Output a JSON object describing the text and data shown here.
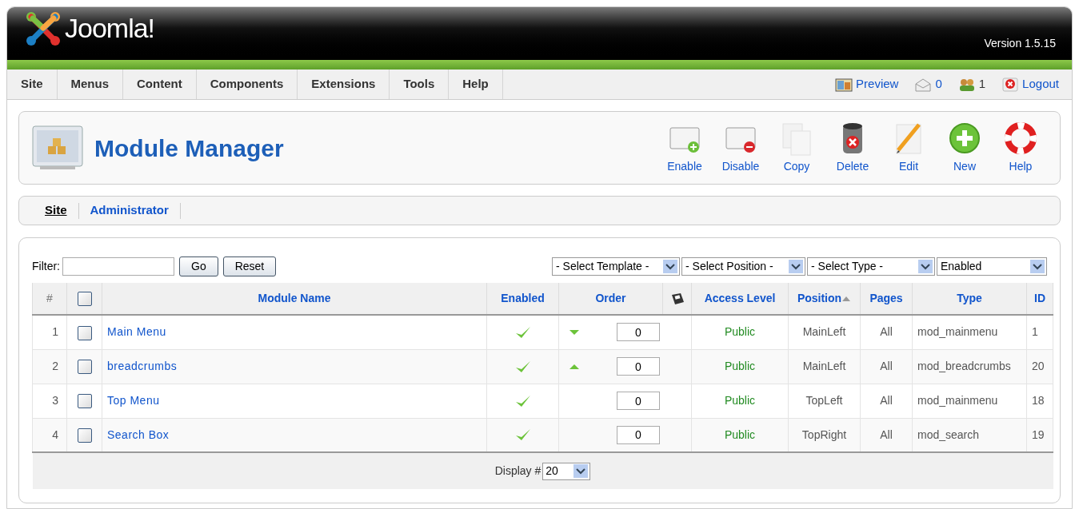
{
  "header": {
    "logo_text": "Joomla!",
    "version": "Version 1.5.15"
  },
  "menu": [
    "Site",
    "Menus",
    "Content",
    "Components",
    "Extensions",
    "Tools",
    "Help"
  ],
  "status": [
    {
      "kind": "preview",
      "label": "Preview"
    },
    {
      "kind": "messages",
      "label": "0"
    },
    {
      "kind": "users",
      "label": "1"
    },
    {
      "kind": "logout",
      "label": "Logout"
    }
  ],
  "toolbar": {
    "title": "Module Manager",
    "buttons": [
      {
        "kind": "enable",
        "label": "Enable"
      },
      {
        "kind": "disable",
        "label": "Disable"
      },
      {
        "kind": "copy",
        "label": "Copy"
      },
      {
        "kind": "delete",
        "label": "Delete"
      },
      {
        "kind": "edit",
        "label": "Edit"
      },
      {
        "kind": "new",
        "label": "New"
      },
      {
        "kind": "help",
        "label": "Help"
      }
    ]
  },
  "subtabs": [
    {
      "label": "Site",
      "selected": true
    },
    {
      "label": "Administrator",
      "selected": false
    }
  ],
  "filter": {
    "label": "Filter:",
    "buttons": [
      "Go",
      "Reset"
    ],
    "selects": [
      "- Select Template -",
      "- Select Position -",
      "- Select Type -",
      "Enabled"
    ]
  },
  "table": {
    "columns": [
      {
        "kind": "number",
        "label": "#"
      },
      {
        "kind": "checkbox",
        "checked": false
      },
      {
        "kind": "text",
        "label": "Module Name"
      },
      {
        "kind": "text",
        "label": "Enabled"
      },
      {
        "kind": "text",
        "label": "Order"
      },
      {
        "kind": "save"
      },
      {
        "kind": "text",
        "label": "Access Level"
      },
      {
        "kind": "text",
        "label": "Position",
        "sorted": true
      },
      {
        "kind": "text",
        "label": "Pages"
      },
      {
        "kind": "text",
        "label": "Type"
      },
      {
        "kind": "text",
        "label": "ID"
      }
    ],
    "rows": [
      {
        "num": "1",
        "checked": false,
        "name": "Main Menu",
        "enabled": true,
        "move_up": false,
        "move_down": true,
        "order": "0",
        "access": "Public",
        "position": "MainLeft",
        "pages": "All",
        "type": "mod_mainmenu",
        "id": "1"
      },
      {
        "num": "2",
        "checked": false,
        "name": "breadcrumbs",
        "enabled": true,
        "move_up": true,
        "move_down": false,
        "order": "0",
        "access": "Public",
        "position": "MainLeft",
        "pages": "All",
        "type": "mod_breadcrumbs",
        "id": "20"
      },
      {
        "num": "3",
        "checked": false,
        "name": "Top Menu",
        "enabled": true,
        "move_up": false,
        "move_down": false,
        "order": "0",
        "access": "Public",
        "position": "TopLeft",
        "pages": "All",
        "type": "mod_mainmenu",
        "id": "18"
      },
      {
        "num": "4",
        "checked": false,
        "name": "Search Box",
        "enabled": true,
        "move_up": false,
        "move_down": false,
        "order": "0",
        "access": "Public",
        "position": "TopRight",
        "pages": "All",
        "type": "mod_search",
        "id": "19"
      }
    ]
  },
  "footer": {
    "label": "Display #",
    "value": "20"
  }
}
